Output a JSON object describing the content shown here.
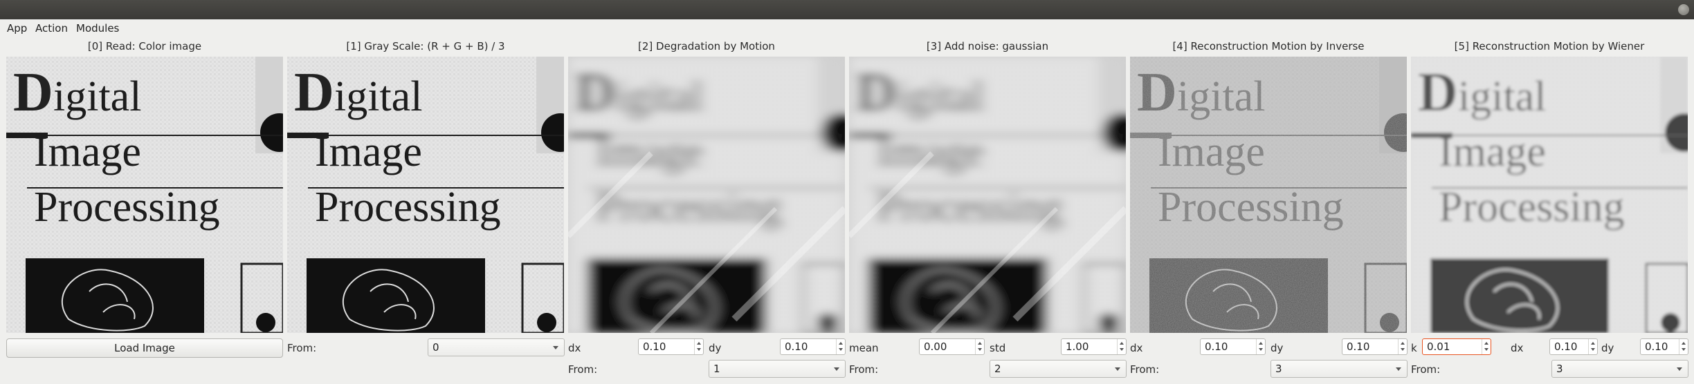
{
  "menu": {
    "app": "App",
    "action": "Action",
    "modules": "Modules"
  },
  "panels": [
    {
      "title": "[0] Read: Color image",
      "button": "Load Image"
    },
    {
      "title": "[1] Gray Scale: (R + G + B) / 3",
      "from_label": "From:",
      "from_value": "0"
    },
    {
      "title": "[2] Degradation by Motion",
      "dx_label": "dx",
      "dx": "0.10",
      "dy_label": "dy",
      "dy": "0.10",
      "from_label": "From:",
      "from_value": "1"
    },
    {
      "title": "[3] Add noise: gaussian",
      "mean_label": "mean",
      "mean": "0.00",
      "std_label": "std",
      "std": "1.00",
      "from_label": "From:",
      "from_value": "2"
    },
    {
      "title": "[4] Reconstruction Motion by Inverse",
      "dx_label": "dx",
      "dx": "0.10",
      "dy_label": "dy",
      "dy": "0.10",
      "from_label": "From:",
      "from_value": "3"
    },
    {
      "title": "[5] Reconstruction Motion by Wiener",
      "k_label": "k",
      "k": "0.01",
      "dx_label": "dx",
      "dx": "0.10",
      "dy_label": "dy",
      "dy": "0.10",
      "from_label": "From:",
      "from_value": "3"
    }
  ],
  "image_text": {
    "line1_cap": "D",
    "line1_rest": "igital",
    "line2": "Image",
    "line3": "Processing"
  }
}
